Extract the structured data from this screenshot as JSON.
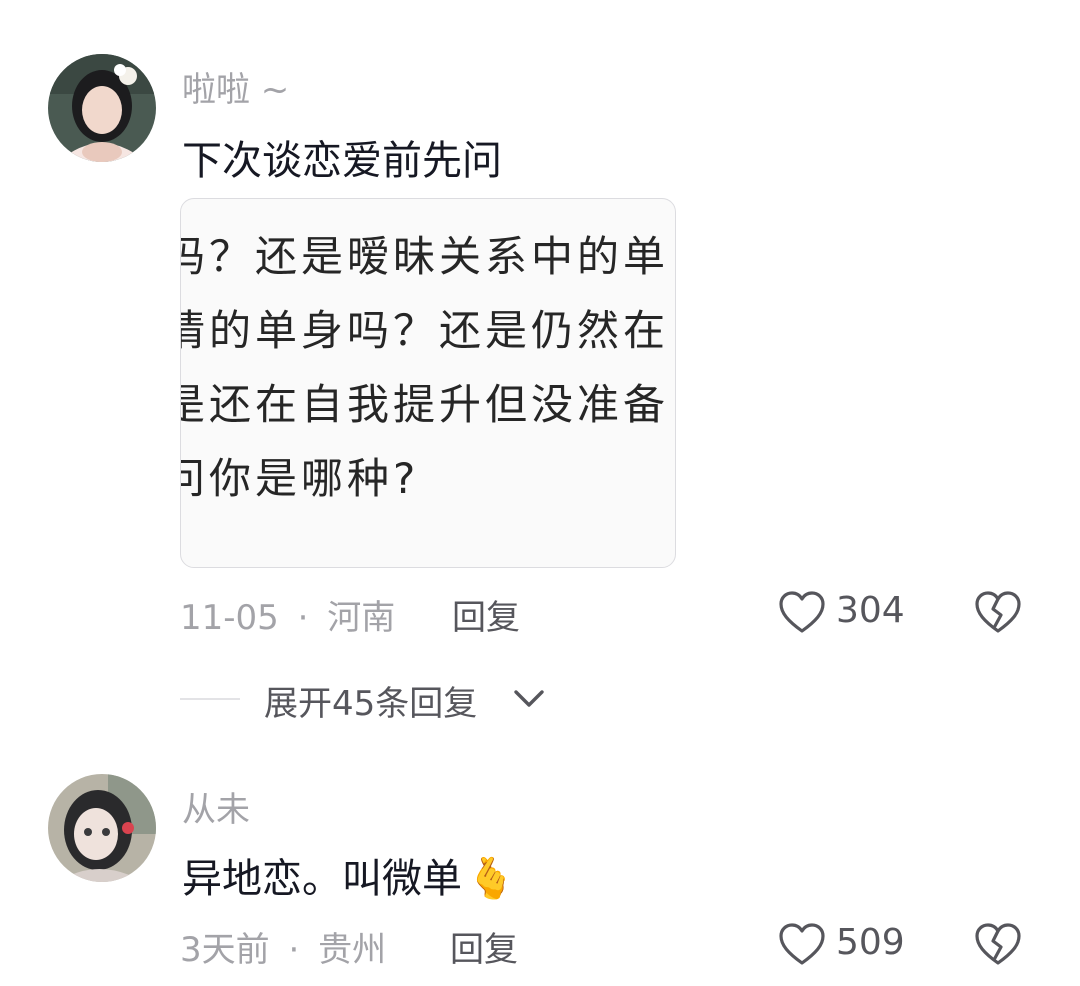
{
  "comments": [
    {
      "username": "啦啦 ~",
      "text": "下次谈恋爱前先问",
      "image_lines": [
        "吗？还是暧昧关系中的单",
        "情的单身吗？还是仍然在",
        "是还在自我提升但没准备",
        "问你是哪种?"
      ],
      "date": "11-05",
      "location": "河南",
      "separator": "·",
      "reply_label": "回复",
      "likes": "304",
      "expand_label": "展开45条回复"
    },
    {
      "username": "从未",
      "text": "异地恋。叫微单",
      "emoji": "🫰",
      "date": "3天前",
      "location": "贵州",
      "separator": "·",
      "reply_label": "回复",
      "likes": "509"
    }
  ],
  "icons": {
    "like": "heart-outline-icon",
    "dislike": "broken-heart-icon",
    "expand": "chevron-down-icon"
  },
  "colors": {
    "primary_text": "#161823",
    "secondary_text": "#a3a3a8",
    "action_text": "#56565c"
  }
}
